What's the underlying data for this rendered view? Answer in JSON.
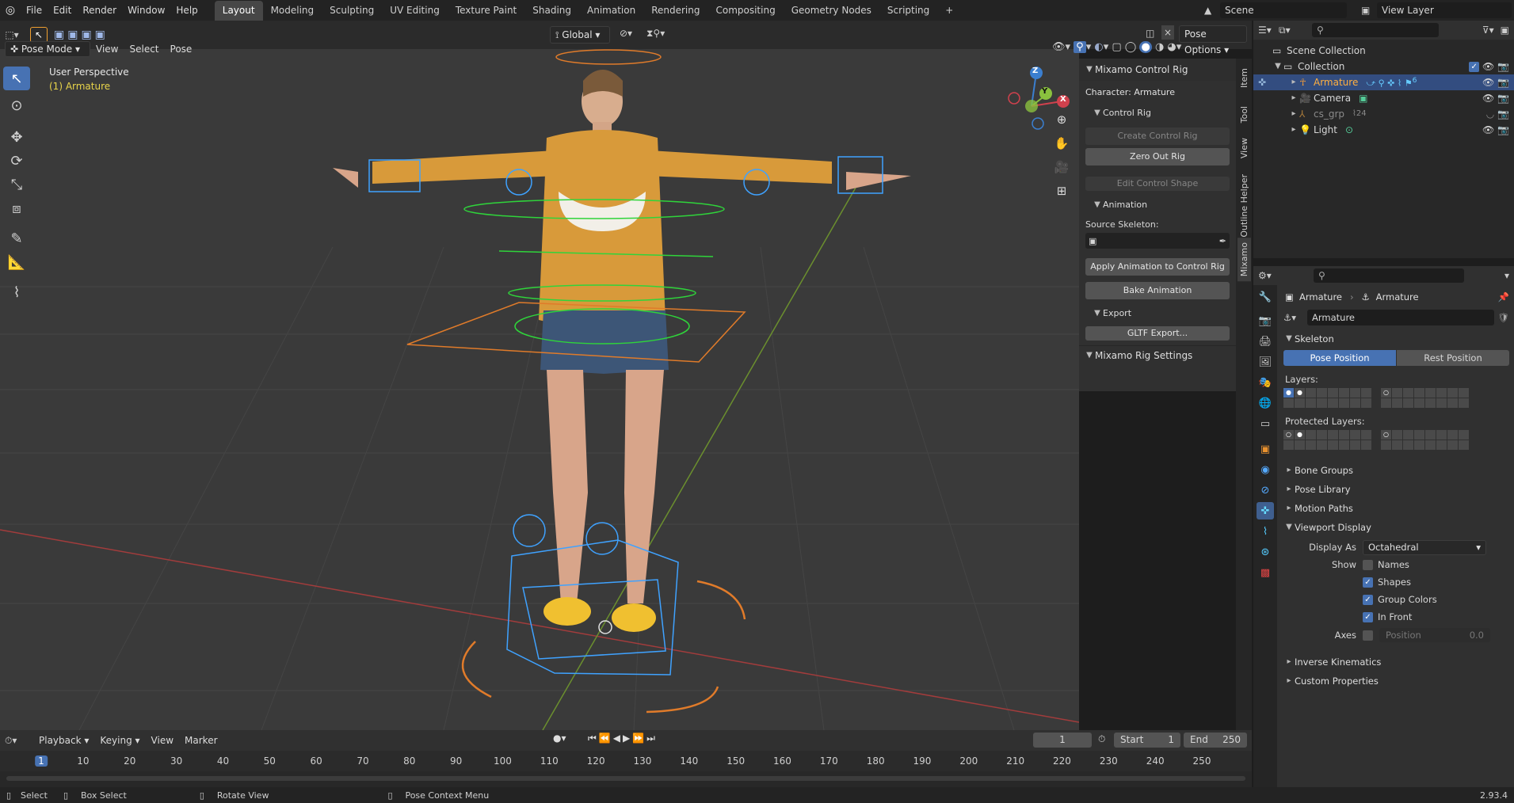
{
  "topbar": {
    "menus": [
      "File",
      "Edit",
      "Render",
      "Window",
      "Help"
    ],
    "workspaces": [
      "Layout",
      "Modeling",
      "Sculpting",
      "UV Editing",
      "Texture Paint",
      "Shading",
      "Animation",
      "Rendering",
      "Compositing",
      "Geometry Nodes",
      "Scripting"
    ],
    "active_workspace": "Layout",
    "add_tab": "+",
    "scene_label": "Scene",
    "view_layer_label": "View Layer"
  },
  "viewport_header": {
    "mode": "Pose Mode",
    "menus": [
      "View",
      "Select",
      "Pose"
    ],
    "transform_orientation": "Global",
    "pose_options": "Pose Options"
  },
  "viewport": {
    "perspective_label": "User Perspective",
    "object_label": "(1) Armature",
    "gizmo_axes": [
      "Z",
      "Y",
      "X"
    ]
  },
  "sidebar": {
    "tabs": [
      "Item",
      "Tool",
      "View",
      "Outline Helper",
      "Mixamo"
    ],
    "active_tab": "Mixamo",
    "control_rig_panel": "Mixamo Control Rig",
    "character_label": "Character: Armature",
    "control_rig_sub": "Control Rig",
    "create_control_rig": "Create Control Rig",
    "zero_out_rig": "Zero Out Rig",
    "edit_control_shape": "Edit Control Shape",
    "animation_sub": "Animation",
    "source_skeleton_label": "Source Skeleton:",
    "apply_animation": "Apply Animation to Control Rig",
    "bake_animation": "Bake Animation",
    "export_sub": "Export",
    "gltf_export": "GLTF Export...",
    "rig_settings_panel": "Mixamo Rig Settings"
  },
  "outliner": {
    "search_placeholder": "",
    "scene_collection": "Scene Collection",
    "collection": "Collection",
    "items": [
      {
        "name": "Armature",
        "selected": true,
        "badge": "6"
      },
      {
        "name": "Camera",
        "selected": false,
        "badge": ""
      },
      {
        "name": "cs_grp",
        "selected": false,
        "badge": "24"
      },
      {
        "name": "Light",
        "selected": false,
        "badge": ""
      }
    ]
  },
  "properties": {
    "breadcrumb_object": "Armature",
    "breadcrumb_data": "Armature",
    "data_name": "Armature",
    "skeleton_panel": "Skeleton",
    "pose_position": "Pose Position",
    "rest_position": "Rest Position",
    "layers_label": "Layers:",
    "protected_layers_label": "Protected Layers:",
    "panels_collapsed": [
      "Bone Groups",
      "Pose Library",
      "Motion Paths"
    ],
    "viewport_display_panel": "Viewport Display",
    "display_as_label": "Display As",
    "display_as_value": "Octahedral",
    "show_label": "Show",
    "names_label": "Names",
    "shapes_label": "Shapes",
    "group_colors_label": "Group Colors",
    "in_front_label": "In Front",
    "axes_label": "Axes",
    "axes_position_label": "Position",
    "axes_position_value": "0.0",
    "panels_bottom": [
      "Inverse Kinematics",
      "Custom Properties"
    ],
    "checks": {
      "names": false,
      "shapes": true,
      "group_colors": true,
      "in_front": true,
      "axes": false
    }
  },
  "timeline": {
    "menus": [
      "Playback",
      "Keying",
      "View",
      "Marker"
    ],
    "current_frame": "1",
    "start_label": "Start",
    "start_value": "1",
    "end_label": "End",
    "end_value": "250",
    "ticks": [
      "1",
      "10",
      "20",
      "30",
      "40",
      "50",
      "60",
      "70",
      "80",
      "90",
      "100",
      "110",
      "120",
      "130",
      "140",
      "150",
      "160",
      "170",
      "180",
      "190",
      "200",
      "210",
      "220",
      "230",
      "240",
      "250"
    ]
  },
  "statusbar": {
    "select": "Select",
    "box_select": "Box Select",
    "rotate_view": "Rotate View",
    "context_menu": "Pose Context Menu",
    "version": "2.93.4"
  },
  "colors": {
    "accent": "#4772b3",
    "selected_row": "#334d80",
    "bone_blue": "#3fa2ff",
    "bone_orange": "#e07b2a",
    "bone_green": "#2fd43a"
  }
}
